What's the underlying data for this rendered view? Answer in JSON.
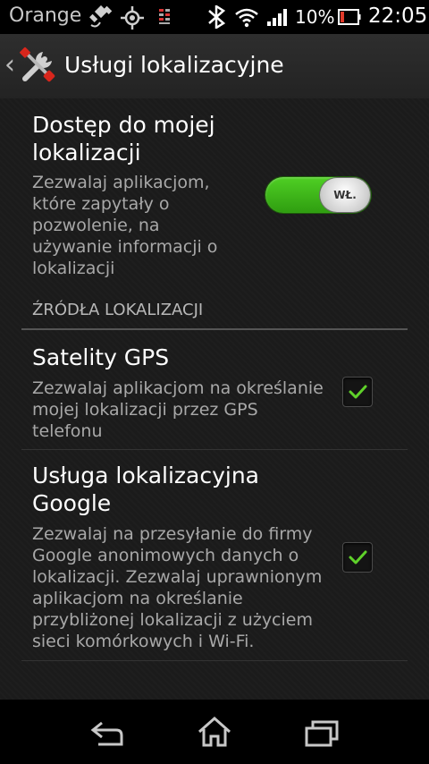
{
  "status_bar": {
    "carrier": "Orange",
    "battery_percent": "10%",
    "time": "22:05",
    "icons": [
      "gps-icon",
      "location-icon",
      "data-transfer-icon",
      "bluetooth-icon",
      "wifi-icon",
      "signal-icon",
      "battery-icon"
    ]
  },
  "action_bar": {
    "title": "Usługi lokalizacyjne",
    "icon": "tools-icon"
  },
  "main_setting": {
    "title_line1": "Dostęp do mojej",
    "title_line2": "lokalizacji",
    "summary_lines": [
      "Zezwalaj aplikacjom,",
      "które zapytały o",
      "pozwolenie, na",
      "używanie informacji o",
      "lokalizacji"
    ],
    "toggle_label": "WŁ.",
    "toggle_on": true
  },
  "section": {
    "header": "ŹRÓDŁA LOKALIZACJI"
  },
  "gps_setting": {
    "title": "Satelity GPS",
    "summary_lines": [
      "Zezwalaj aplikacjom na określanie",
      "mojej lokalizacji przez GPS",
      "telefonu"
    ],
    "checked": true
  },
  "google_setting": {
    "title_line1": "Usługa lokalizacyjna",
    "title_line2": "Google",
    "summary_lines": [
      "Zezwalaj na przesyłanie do firmy",
      "Google anonimowych danych o",
      "lokalizacji. Zezwalaj uprawnionym",
      "aplikacjom na określanie",
      "przybliżonej lokalizacji z użyciem",
      "sieci komórkowych i Wi-Fi."
    ],
    "checked": true
  },
  "colors": {
    "toggle_green": "#3fb81a",
    "check_green": "#5fd12a",
    "background": "#1b1b1b"
  },
  "nav_bar": {
    "icons": [
      "back-icon",
      "home-icon",
      "recent-apps-icon"
    ]
  }
}
